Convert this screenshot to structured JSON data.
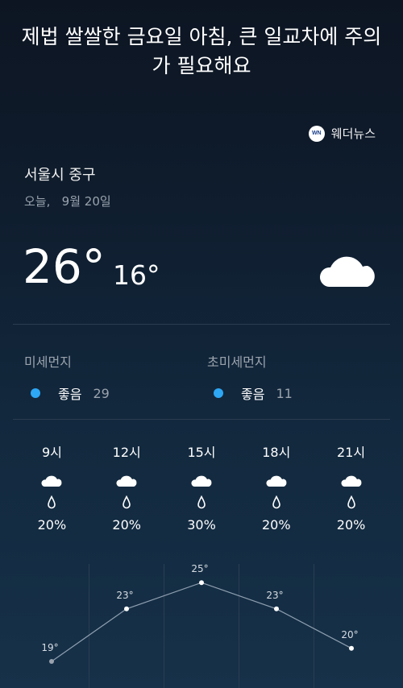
{
  "headline": "제법 쌀쌀한 금요일 아침, 큰 일교차에 주의가 필요해요",
  "source": {
    "logo_text": "WN",
    "name": "웨더뉴스"
  },
  "location": "서울시 중구",
  "date": "오늘,   9월 20일",
  "current": {
    "high": "26°",
    "low": "16°",
    "condition_icon": "cloud-icon"
  },
  "air_quality": [
    {
      "label": "미세먼지",
      "status": "좋음",
      "value": "29",
      "color": "#2ea7f5"
    },
    {
      "label": "초미세먼지",
      "status": "좋음",
      "value": "11",
      "color": "#2ea7f5"
    }
  ],
  "hourly": [
    {
      "time": "9시",
      "precip": "20%",
      "temp_label": "19°",
      "temp": 19,
      "icon": "cloud-icon"
    },
    {
      "time": "12시",
      "precip": "20%",
      "temp_label": "23°",
      "temp": 23,
      "icon": "cloud-icon"
    },
    {
      "time": "15시",
      "precip": "30%",
      "temp_label": "25°",
      "temp": 25,
      "icon": "cloud-icon"
    },
    {
      "time": "18시",
      "precip": "20%",
      "temp_label": "23°",
      "temp": 23,
      "icon": "cloud-icon"
    },
    {
      "time": "21시",
      "precip": "20%",
      "temp_label": "20°",
      "temp": 20,
      "icon": "cloud-icon"
    }
  ]
}
